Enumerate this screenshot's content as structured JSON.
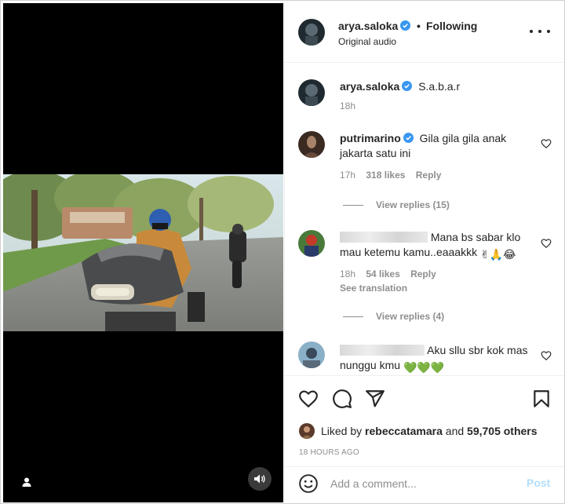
{
  "header": {
    "username": "arya.saloka",
    "separator": "•",
    "follow_status": "Following",
    "subtitle": "Original audio"
  },
  "comments": [
    {
      "username": "arya.saloka",
      "text": "S.a.b.a.r",
      "time": "18h",
      "verified": true
    },
    {
      "username": "putrimarino",
      "text": "Gila gila gila anak jakarta satu ini",
      "time": "17h",
      "likes": "318 likes",
      "reply": "Reply",
      "view_replies": "View replies (15)",
      "verified": true
    },
    {
      "username": "",
      "text": "Mana bs sabar klo mau ketemu kamu..eaaakkk",
      "emoji": "✌🙏😂",
      "time": "18h",
      "likes": "54 likes",
      "reply": "Reply",
      "see_translation": "See translation",
      "view_replies": "View replies (4)"
    },
    {
      "username": "",
      "text": "Aku sllu sbr kok mas nunggu kmu",
      "emoji": "💚💚💚"
    }
  ],
  "likes": {
    "prefix": "Liked by",
    "user": "rebeccatamara",
    "conj": "and",
    "others": "59,705 others"
  },
  "timestamp": "18 HOURS AGO",
  "comment_box": {
    "placeholder": "Add a comment...",
    "post_label": "Post"
  },
  "icons": {
    "like": "heart-icon",
    "comment": "comment-icon",
    "share": "share-icon",
    "save": "bookmark-icon",
    "emoji": "emoji-icon",
    "more": "more-options-icon",
    "audio": "speaker-icon",
    "tags": "user-tag-icon"
  },
  "colors": {
    "verified": "#3897f0",
    "muted_text": "#8e8e8e",
    "post_button_disabled": "#b2dffc",
    "heart_green": "#2fbf1f"
  }
}
